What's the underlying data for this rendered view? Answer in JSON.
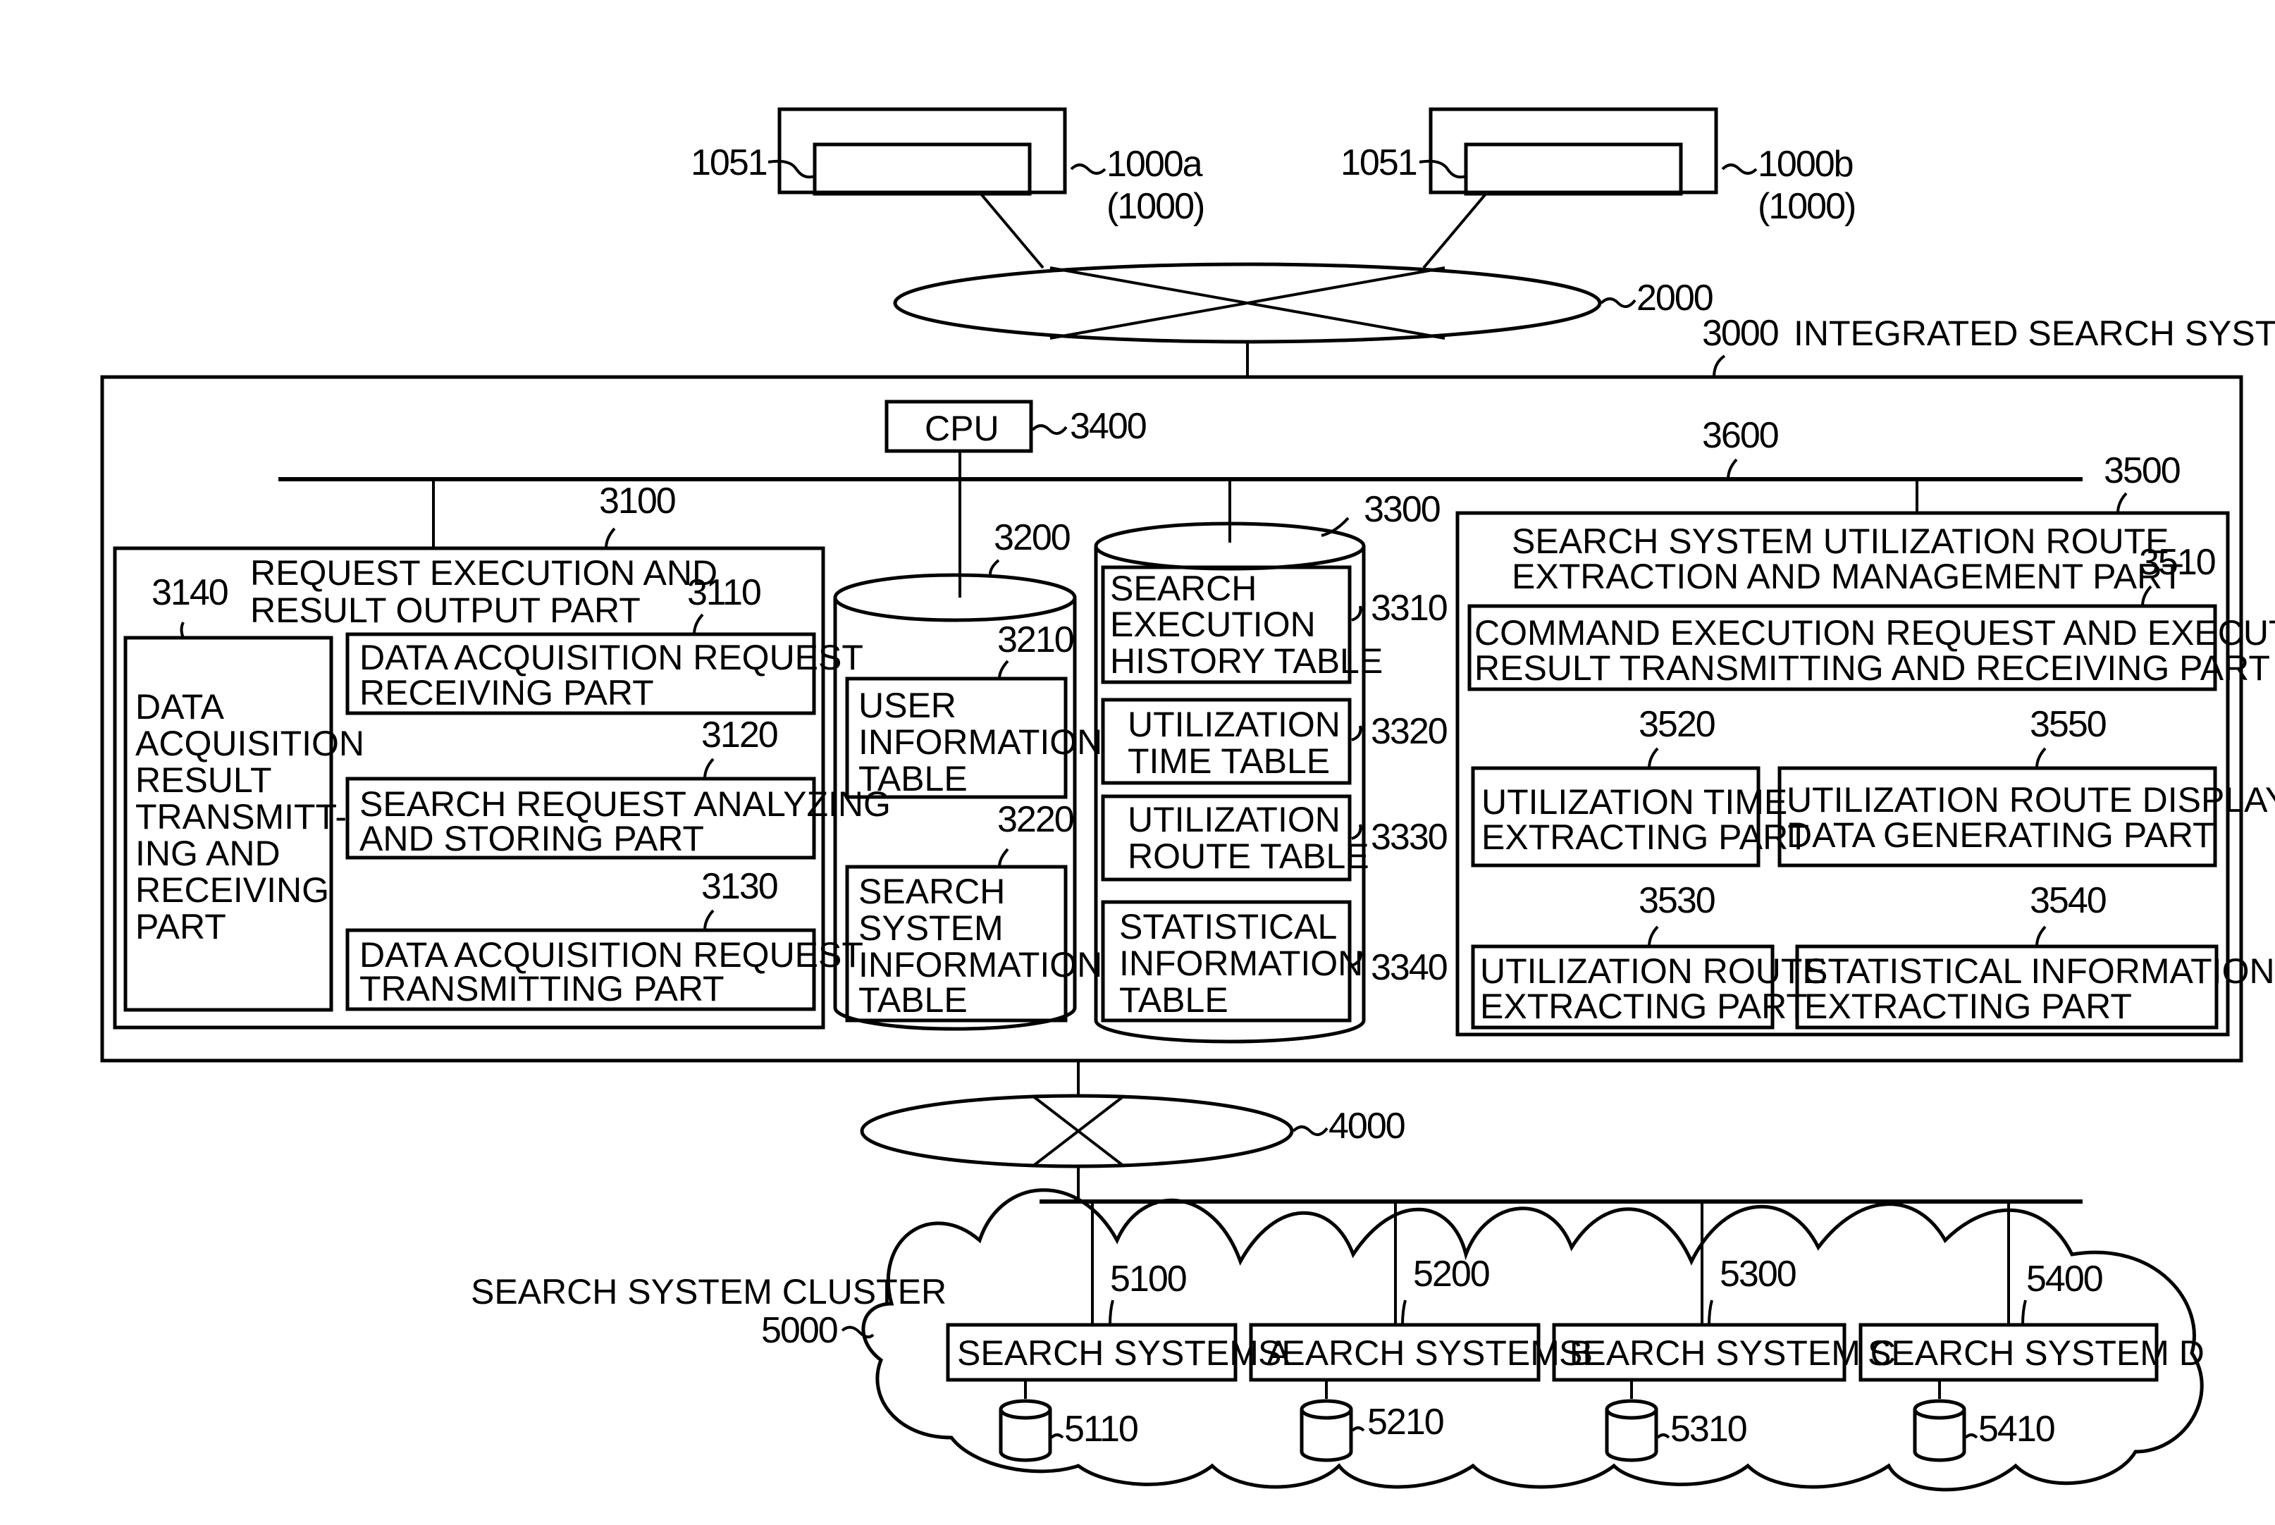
{
  "figure": {
    "terminals": [
      {
        "ref": "1000a",
        "group": "(1000)",
        "display_ref": "1051"
      },
      {
        "ref": "1000b",
        "group": "(1000)",
        "display_ref": "1051"
      }
    ],
    "network_top": "2000",
    "system": {
      "ref": "3000",
      "title": "INTEGRATED SEARCH SYSTEM"
    },
    "cpu": {
      "label": "CPU",
      "ref": "3400"
    },
    "bus_ref": "3600",
    "part3100": {
      "ref": "3100",
      "title": [
        "REQUEST EXECUTION AND",
        "RESULT OUTPUT PART"
      ],
      "p3140": {
        "ref": "3140",
        "lines": [
          "DATA",
          "ACQUISITION",
          "RESULT",
          "TRANSMITT-",
          "ING AND",
          "RECEIVING",
          "PART"
        ]
      },
      "p3110": {
        "ref": "3110",
        "lines": [
          "DATA ACQUISITION REQUEST",
          "RECEIVING PART"
        ]
      },
      "p3120": {
        "ref": "3120",
        "lines": [
          "SEARCH REQUEST ANALYZING",
          "AND STORING PART"
        ]
      },
      "p3130": {
        "ref": "3130",
        "lines": [
          "DATA ACQUISITION REQUEST",
          "TRANSMITTING PART"
        ]
      }
    },
    "db3200": {
      "ref": "3200",
      "t3210": {
        "ref": "3210",
        "lines": [
          "USER",
          "INFORMATION",
          "TABLE"
        ]
      },
      "t3220": {
        "ref": "3220",
        "lines": [
          "SEARCH",
          "SYSTEM",
          "INFORMATION",
          "TABLE"
        ]
      }
    },
    "db3300": {
      "ref": "3300",
      "t3310": {
        "ref": "3310",
        "lines": [
          "SEARCH",
          "EXECUTION",
          "HISTORY TABLE"
        ]
      },
      "t3320": {
        "ref": "3320",
        "lines": [
          "UTILIZATION",
          "TIME TABLE"
        ]
      },
      "t3330": {
        "ref": "3330",
        "lines": [
          "UTILIZATION",
          "ROUTE TABLE"
        ]
      },
      "t3340": {
        "ref": "3340",
        "lines": [
          "STATISTICAL",
          "INFORMATION",
          "TABLE"
        ]
      }
    },
    "part3500": {
      "ref": "3500",
      "title": [
        "SEARCH SYSTEM UTILIZATION ROUTE",
        "EXTRACTION AND MANAGEMENT PART"
      ],
      "p3510": {
        "ref": "3510",
        "lines": [
          "COMMAND EXECUTION REQUEST AND EXECUTION",
          "RESULT TRANSMITTING AND RECEIVING PART"
        ]
      },
      "p3520": {
        "ref": "3520",
        "lines": [
          "UTILIZATION TIME",
          "EXTRACTING PART"
        ]
      },
      "p3550": {
        "ref": "3550",
        "lines": [
          "UTILIZATION ROUTE DISPLAY",
          "DATA GENERATING PART"
        ]
      },
      "p3530": {
        "ref": "3530",
        "lines": [
          "UTILIZATION ROUTE",
          "EXTRACTING PART"
        ]
      },
      "p3540": {
        "ref": "3540",
        "lines": [
          "STATISTICAL INFORMATION",
          "EXTRACTING PART"
        ]
      }
    },
    "network_bottom": "4000",
    "cluster": {
      "label": "SEARCH SYSTEM CLUSTER",
      "ref": "5000",
      "systems": [
        {
          "ref": "5100",
          "label": "SEARCH SYSTEM A",
          "db": "5110"
        },
        {
          "ref": "5200",
          "label": "SEARCH SYSTEM B",
          "db": "5210"
        },
        {
          "ref": "5300",
          "label": "SEARCH SYSTEM C",
          "db": "5310"
        },
        {
          "ref": "5400",
          "label": "SEARCH SYSTEM D",
          "db": "5410"
        }
      ]
    }
  }
}
